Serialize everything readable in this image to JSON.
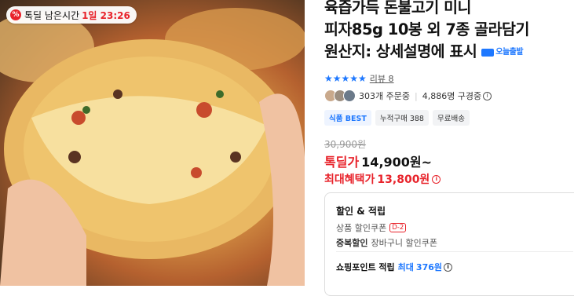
{
  "banner": {
    "label": "톡딜 남은시간",
    "time": "1일 23:26",
    "icon": "percent-badge-icon"
  },
  "product": {
    "title_lines": [
      "육즙가득 돈불고기 미니",
      "피자85g 10봉 외 7종 골라담기",
      "원산지: 상세설명에 표시"
    ],
    "delivery_badge": "오늘출발",
    "review_label": "리뷰 8",
    "stars": "★★★★★",
    "orders": "303개 주문중",
    "viewers": "4,886명 구경중",
    "tags": [
      "식품 BEST",
      "누적구매 388",
      "무료배송"
    ]
  },
  "price": {
    "original": "30,900원",
    "deal_label": "톡딜가",
    "deal_price": "14,900원~",
    "max_label": "최대혜택가",
    "max_price": "13,800원"
  },
  "benefits": {
    "title": "할인 & 적립",
    "coupon_label": "상품 할인쿠폰",
    "coupon_badge": "D-2",
    "dup_label": "중복할인",
    "dup_value": "장바구니 할인쿠폰",
    "point_label": "쇼핑포인트 적립",
    "point_prefix": "최대",
    "point_value": "376원"
  },
  "colors": {
    "accent_red": "#e8232b",
    "accent_blue": "#1e78ff"
  }
}
